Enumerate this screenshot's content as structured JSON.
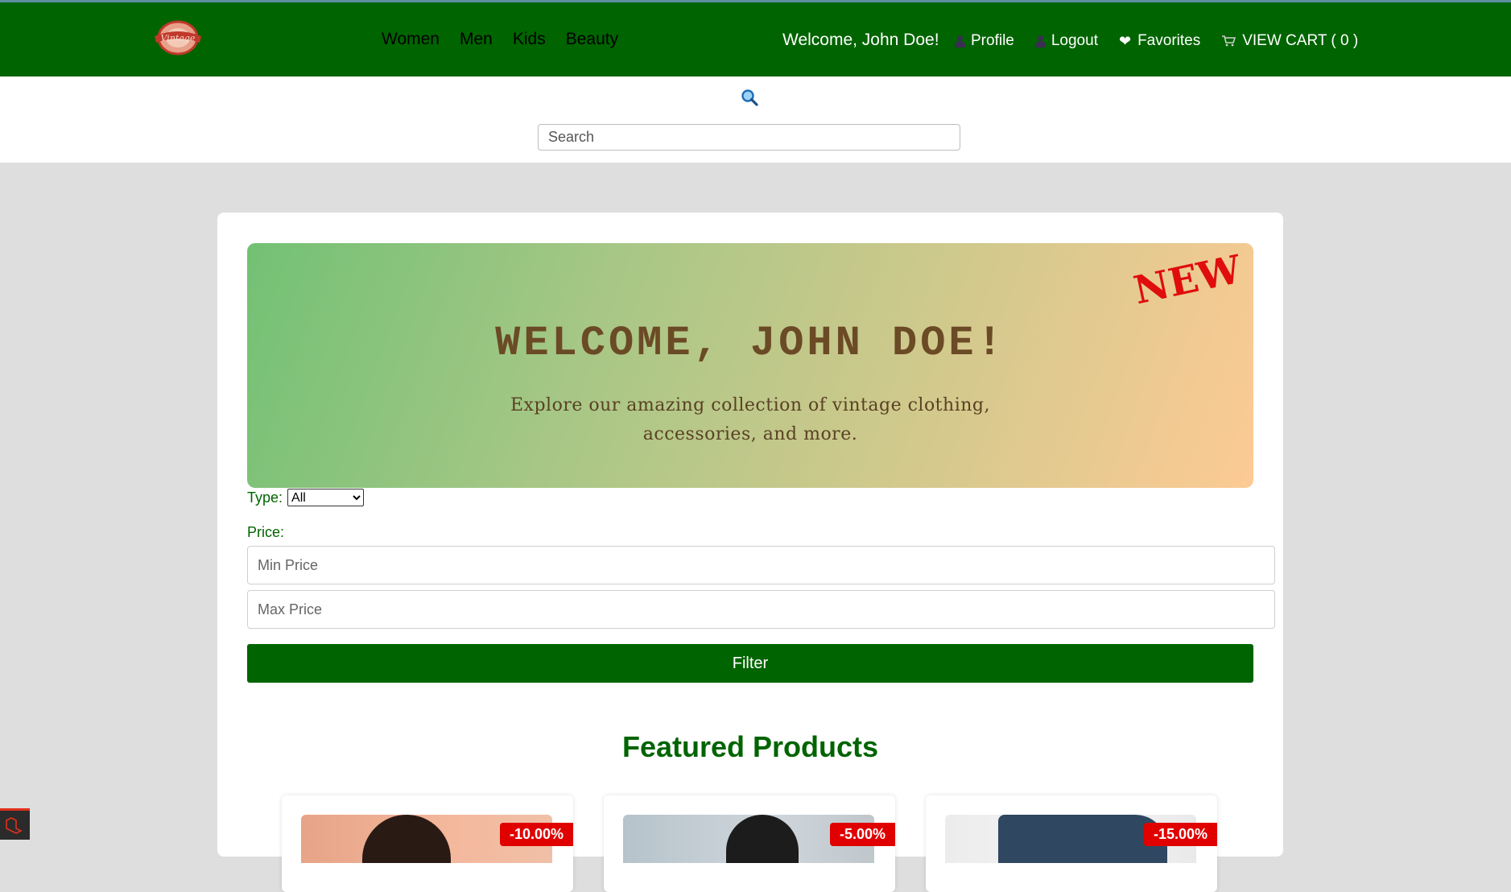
{
  "header": {
    "nav": [
      "Women",
      "Men",
      "Kids",
      "Beauty"
    ],
    "welcome": "Welcome, John Doe!",
    "profile_label": "Profile",
    "logout_label": "Logout",
    "favorites_label": "Favorites",
    "cart_label": "VIEW CART ( 0 )",
    "brand_color": "#006400"
  },
  "search": {
    "placeholder": "Search"
  },
  "hero": {
    "badge": "NEW",
    "title": "WELCOME, JOHN DOE!",
    "subtitle": "Explore our amazing collection of vintage clothing, accessories, and more."
  },
  "filters": {
    "type_label": "Type:",
    "type_selected": "All",
    "price_label": "Price:",
    "min_placeholder": "Min Price",
    "max_placeholder": "Max Price",
    "filter_button": "Filter"
  },
  "featured": {
    "title": "Featured Products",
    "products": [
      {
        "discount": "-10.00%"
      },
      {
        "discount": "-5.00%"
      },
      {
        "discount": "-15.00%"
      }
    ]
  }
}
